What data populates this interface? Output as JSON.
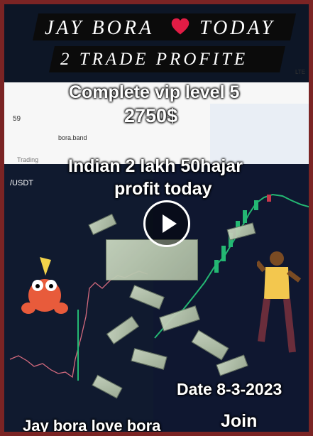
{
  "header": {
    "line1_left": "JAY BORA",
    "line1_right": "TODAY",
    "line2": "2 TRADE PROFITE"
  },
  "overlay": {
    "vip": "Complete vip level 5",
    "amount": "2750$",
    "indian": "Indian 2 lakh 50hajar",
    "profit": "profit today",
    "date": "Date 8-3-2023",
    "footer_left": "Jay bora love bora",
    "footer_right": "Join"
  },
  "app": {
    "site": "bora.band",
    "pair": "/USDT",
    "number": "59",
    "lte": "LTE",
    "small_label": "Trading"
  },
  "colors": {
    "heart": "#e21c45",
    "green": "#1fa76a",
    "red": "#c7374b",
    "frame": "#7b2424"
  },
  "icons": {
    "heart": "heart-icon",
    "play": "play-icon"
  }
}
